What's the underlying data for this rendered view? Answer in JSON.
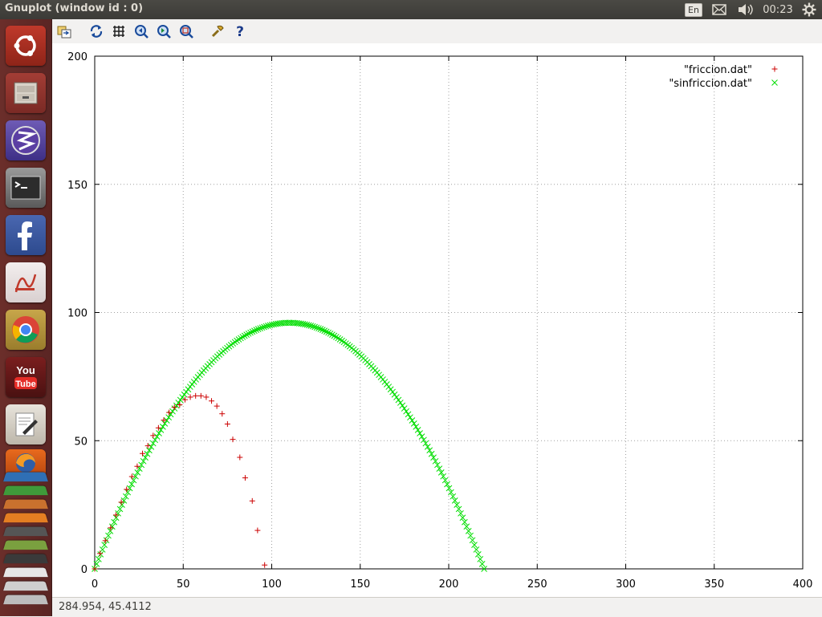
{
  "window": {
    "title": "Gnuplot (window id : 0)"
  },
  "panel": {
    "language": "En",
    "time": "00:23",
    "icons": [
      "mail-icon",
      "volume-icon",
      "gear-icon"
    ]
  },
  "launcher": {
    "items": [
      "ubuntu-dash",
      "files",
      "emacs",
      "terminal",
      "facebook",
      "pdf-viewer",
      "chrome",
      "youtube",
      "text-editor",
      "firefox",
      "libreoffice-writer",
      "libreoffice-calc",
      "libreoffice-impress",
      "amazon",
      "software-center",
      "settings",
      "trash"
    ]
  },
  "toolbar": {
    "icons": [
      "export-icon",
      "replot-icon",
      "grid-icon",
      "zoom-previous-icon",
      "zoom-next-icon",
      "unzoom-icon",
      "options-icon",
      "help-icon"
    ]
  },
  "statusbar": {
    "coords": "284.954,  45.4112"
  },
  "chart_data": {
    "type": "scatter",
    "xlim": [
      0,
      400
    ],
    "ylim": [
      0,
      200
    ],
    "x_ticks": [
      "0",
      "50",
      "100",
      "150",
      "200",
      "250",
      "300",
      "350",
      "400"
    ],
    "y_ticks": [
      "0",
      "50",
      "100",
      "150",
      "200"
    ],
    "grid": true,
    "legend_position": "top-right",
    "series": [
      {
        "name": "\"friccion.dat\"",
        "marker": "+",
        "color": "#cc0000",
        "points": [
          [
            0,
            0
          ],
          [
            3,
            6
          ],
          [
            6,
            11
          ],
          [
            9,
            16
          ],
          [
            12,
            21
          ],
          [
            15,
            26
          ],
          [
            18,
            31
          ],
          [
            21,
            36
          ],
          [
            24,
            40
          ],
          [
            27,
            45
          ],
          [
            30,
            48
          ],
          [
            33,
            52
          ],
          [
            36,
            55
          ],
          [
            39,
            58
          ],
          [
            42,
            61
          ],
          [
            45,
            63
          ],
          [
            48,
            64
          ],
          [
            51,
            66
          ],
          [
            54,
            67
          ],
          [
            57,
            67.5
          ],
          [
            60,
            67.5
          ],
          [
            63,
            67
          ],
          [
            66,
            65.5
          ],
          [
            69,
            63.5
          ],
          [
            72,
            60.5
          ],
          [
            75,
            56.5
          ],
          [
            78,
            50.5
          ],
          [
            82,
            43.5
          ],
          [
            85,
            35.5
          ],
          [
            89,
            26.5
          ],
          [
            92,
            15
          ],
          [
            96,
            1.5
          ]
        ]
      },
      {
        "name": "\"sinfriccion.dat\"",
        "marker": "x",
        "color": "#00dd00",
        "x_range": [
          0,
          220
        ],
        "peak": [
          110,
          96
        ],
        "step": 1.1
      }
    ]
  }
}
